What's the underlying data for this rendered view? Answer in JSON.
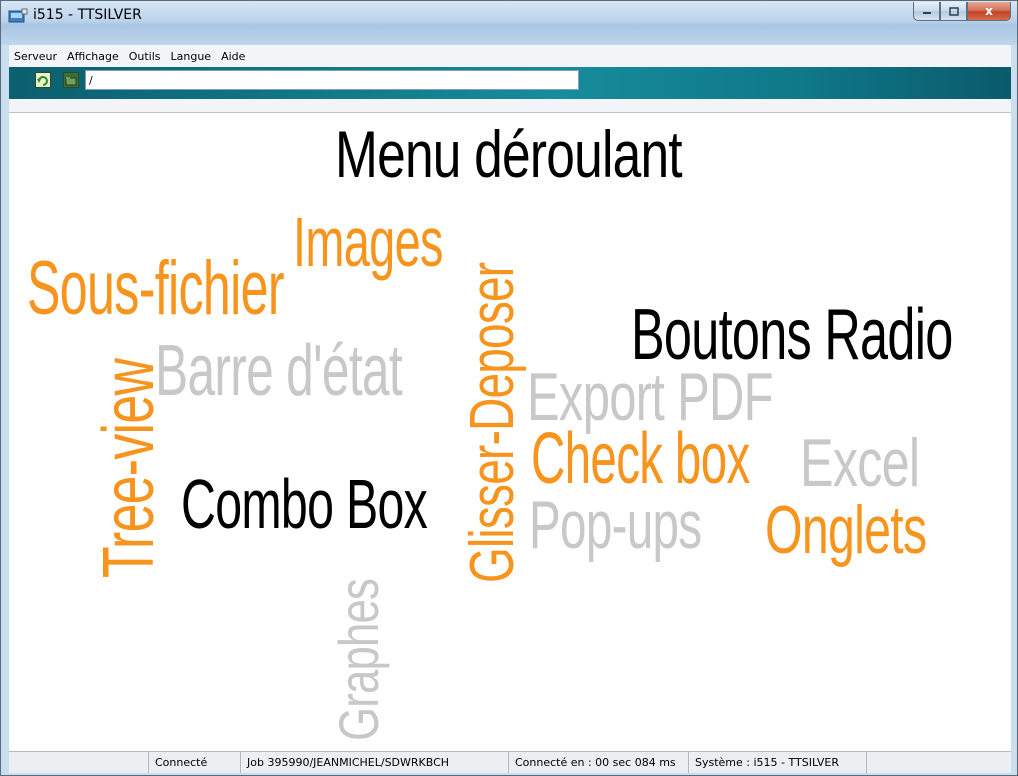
{
  "window": {
    "title": "i515 - TTSILVER",
    "minimize_icon": "minimize-icon",
    "maximize_icon": "maximize-icon",
    "close_glyph": "x"
  },
  "menu": {
    "items": [
      "Serveur",
      "Affichage",
      "Outils",
      "Langue",
      "Aide"
    ]
  },
  "toolbar": {
    "refresh_icon": "refresh-icon",
    "folder_icon": "folder-icon",
    "path_value": "/"
  },
  "word_cloud": {
    "menu_deroulant": "Menu déroulant",
    "images": "Images",
    "glisser_deposer": "Glisser-Deposer",
    "sous_fichier": "Sous-fichier",
    "boutons_radio": "Boutons Radio",
    "tree_view": "Tree-view",
    "barre_etat": "Barre d'état",
    "export_pdf": "Export PDF",
    "check_box": "Check box",
    "excel": "Excel",
    "combo_box": "Combo Box",
    "pop_ups": "Pop-ups",
    "onglets": "Onglets",
    "graphes": "Graphes"
  },
  "colors": {
    "orange": "#f7941d",
    "grey": "#c8c8c8",
    "black": "#000000",
    "toolbar_teal": "#168c9c"
  },
  "statusbar": {
    "status": "Connecté",
    "job": "Job 395990/JEANMICHEL/SDWRKBCH",
    "connect_time": "Connecté en : 00 sec 084 ms",
    "system": "Système : i515 - TTSILVER"
  }
}
